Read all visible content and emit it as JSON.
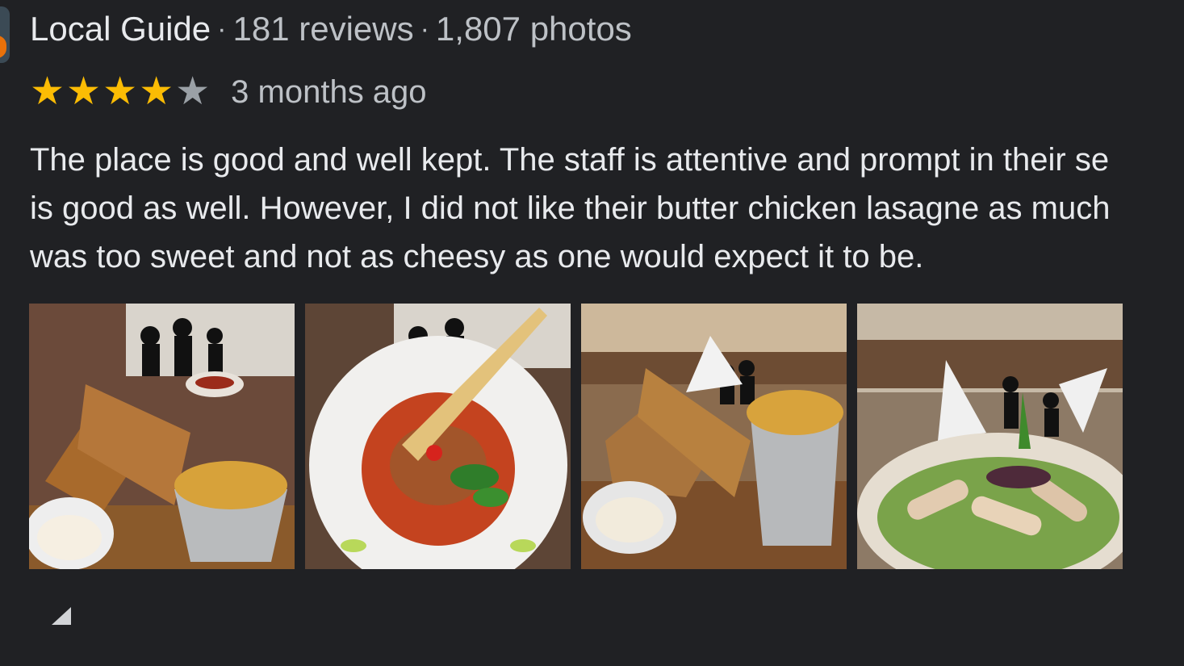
{
  "reviewer": {
    "badge": "Local Guide",
    "reviews": "181 reviews",
    "photos": "1,807 photos",
    "separator": "·"
  },
  "rating": {
    "value": 4,
    "max": 5,
    "stars": [
      "★",
      "★",
      "★",
      "★",
      "★"
    ],
    "time_ago": "3 months ago"
  },
  "review": {
    "lines": [
      "The place is good and well kept. The staff is attentive and prompt in their se",
      "is good as well. However, I did not like their butter chicken lasagne as much",
      "was too sweet and not as cheesy as one would expect it to be."
    ]
  },
  "photos": [
    {
      "subject": "grilled sandwich with potato wedges and dip"
    },
    {
      "subject": "lasagne in tomato sauce with basil and crisp garnish"
    },
    {
      "subject": "grilled sandwich with wedges in metal bucket"
    },
    {
      "subject": "chicken caesar salad"
    }
  ],
  "colors": {
    "background": "#202124",
    "star_on": "#fbbc04",
    "star_off": "#9aa0a6",
    "text_primary": "#e8eaed",
    "text_secondary": "#bdc1c6"
  },
  "icons": {
    "more": "share-arrow-icon"
  }
}
